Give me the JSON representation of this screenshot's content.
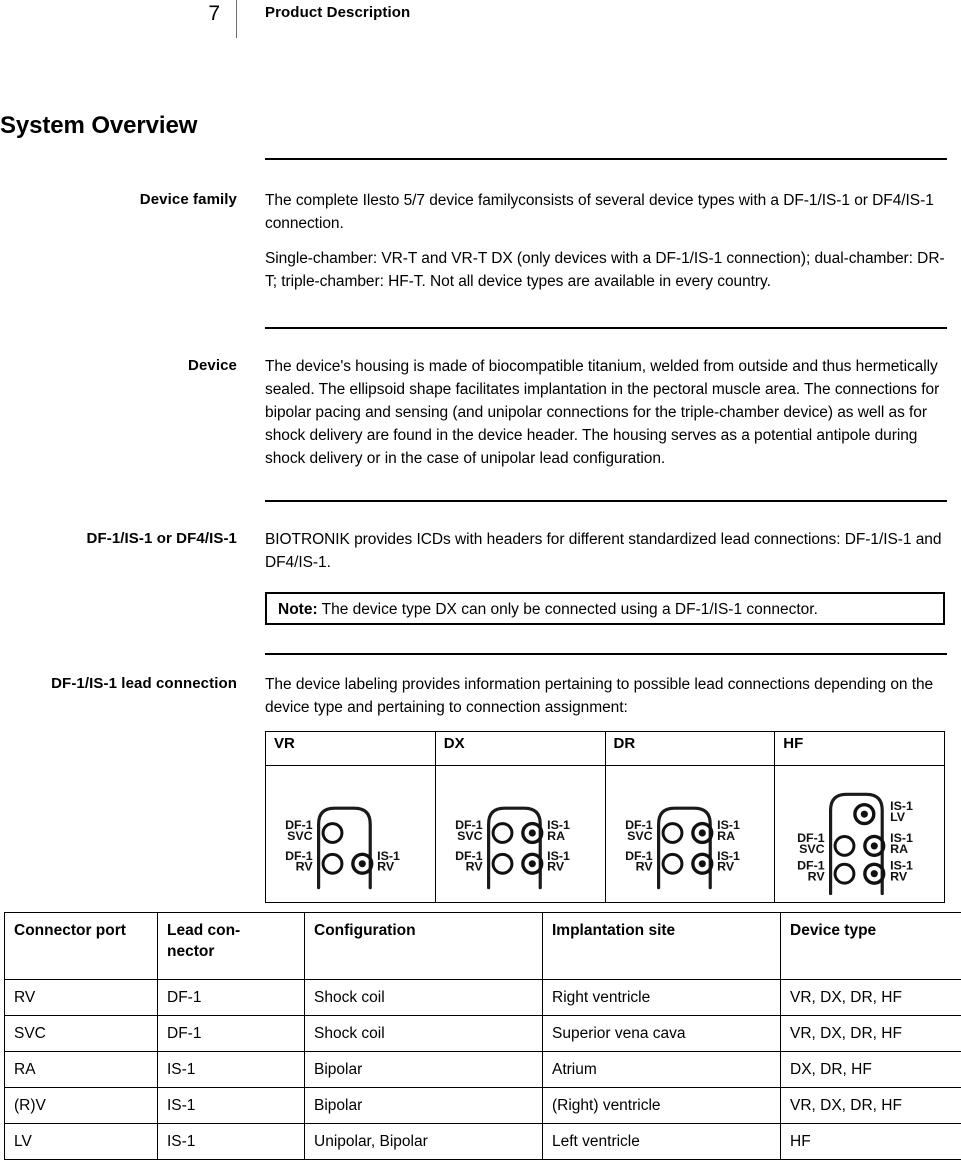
{
  "header": {
    "page_number": "7",
    "title": "Product Description"
  },
  "page_title": "System Overview",
  "sections": [
    {
      "label": "Device family",
      "paragraphs": [
        "The complete Ilesto 5/7 device familyconsists of several device types with a DF-1/IS-1 or DF4/IS-1 connection.",
        "Single-chamber: VR-T and VR-T DX (only devices with a DF-1/IS-1 connection); dual-chamber: DR-T; triple-chamber: HF-T. Not all device types are available in every country."
      ]
    },
    {
      "label": "Device",
      "paragraphs": [
        "The device's housing is made of biocompatible titanium, welded from outside and thus hermetically sealed. The ellipsoid shape facilitates implantation in the pectoral muscle area. The connections for bipolar pacing and sensing (and unipolar connections for the triple-chamber device) as well as for shock delivery are found in the device header. The housing serves as a potential antipole during shock delivery or in the case of unipolar lead configuration."
      ]
    },
    {
      "label": "DF-1/IS-1 or DF4/IS-1",
      "paragraphs": [
        "BIOTRONIK provides ICDs with headers for different standardized lead connections: DF-1/IS-1 and DF4/IS-1."
      ]
    },
    {
      "label": "DF-1/IS-1 lead connection",
      "paragraphs": [
        "The device labeling provides information pertaining to possible lead connections depending on the device type and pertaining to connection assignment:"
      ]
    }
  ],
  "note": {
    "label": "Note:",
    "text": " The device type DX can only be connected using a DF-1/IS-1 connector."
  },
  "diagram_table": {
    "headers": [
      "VR",
      "DX",
      "DR",
      "HF"
    ],
    "cells": [
      {
        "device": "VR",
        "left_labels": [
          "DF-1 SVC",
          "DF-1 RV"
        ],
        "right_labels": [
          "IS-1 RV"
        ],
        "ports": [
          {
            "side": "left",
            "row": 1,
            "type": "open"
          },
          {
            "side": "left",
            "row": 2,
            "type": "open"
          },
          {
            "side": "right",
            "row": 2,
            "type": "filled"
          }
        ]
      },
      {
        "device": "DX",
        "left_labels": [
          "DF-1 SVC",
          "DF-1 RV"
        ],
        "right_labels": [
          "IS-1 RA",
          "IS-1 RV"
        ],
        "ports": [
          {
            "side": "left",
            "row": 1,
            "type": "open"
          },
          {
            "side": "left",
            "row": 2,
            "type": "open"
          },
          {
            "side": "right",
            "row": 1,
            "type": "filled"
          },
          {
            "side": "right",
            "row": 2,
            "type": "filled"
          }
        ]
      },
      {
        "device": "DR",
        "left_labels": [
          "DF-1 SVC",
          "DF-1 RV"
        ],
        "right_labels": [
          "IS-1 RA",
          "IS-1 RV"
        ],
        "ports": [
          {
            "side": "left",
            "row": 1,
            "type": "open"
          },
          {
            "side": "left",
            "row": 2,
            "type": "open"
          },
          {
            "side": "right",
            "row": 1,
            "type": "filled"
          },
          {
            "side": "right",
            "row": 2,
            "type": "filled"
          }
        ]
      },
      {
        "device": "HF",
        "left_labels": [
          "DF-1 SVC",
          "DF-1 RV"
        ],
        "right_labels": [
          "IS-1 LV",
          "IS-1 RA",
          "IS-1 RV"
        ],
        "ports": [
          {
            "side": "right",
            "row": 0,
            "type": "filled"
          },
          {
            "side": "left",
            "row": 1,
            "type": "open"
          },
          {
            "side": "left",
            "row": 2,
            "type": "open"
          },
          {
            "side": "right",
            "row": 1,
            "type": "filled"
          },
          {
            "side": "right",
            "row": 2,
            "type": "filled"
          }
        ]
      }
    ],
    "labels": {
      "df1": "DF-1",
      "is1": "IS-1",
      "svc": "SVC",
      "rv": "RV",
      "ra": "RA",
      "lv": "LV"
    }
  },
  "data_table": {
    "headers": [
      "Connector port",
      "Lead con-nector",
      "Configuration",
      "Implantation site",
      "Device type"
    ],
    "headers_display": {
      "h0": "Connector port",
      "h1_line1": "Lead con-",
      "h1_line2": "nector",
      "h2": "Configuration",
      "h3": "Implantation site",
      "h4": "Device type"
    },
    "rows": [
      {
        "port": "RV",
        "lead": "DF-1",
        "config": "Shock coil",
        "site": "Right ventricle",
        "type": "VR, DX, DR, HF"
      },
      {
        "port": "SVC",
        "lead": "DF-1",
        "config": "Shock coil",
        "site": "Superior vena cava",
        "type": "VR, DX, DR, HF"
      },
      {
        "port": "RA",
        "lead": "IS-1",
        "config": "Bipolar",
        "site": "Atrium",
        "type": "DX, DR, HF"
      },
      {
        "port": "(R)V",
        "lead": "IS-1",
        "config": "Bipolar",
        "site": "(Right) ventricle",
        "type": "VR, DX, DR, HF"
      },
      {
        "port": "LV",
        "lead": "IS-1",
        "config": "Unipolar, Bipolar",
        "site": "Left ventricle",
        "type": "HF"
      }
    ]
  },
  "colors": {
    "text": "#000000",
    "rule": "#000000",
    "header_rule": "#6e6e6e",
    "background": "#ffffff"
  }
}
